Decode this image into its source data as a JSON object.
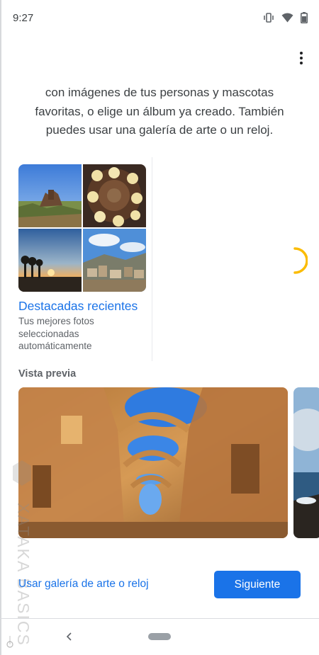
{
  "status_bar": {
    "time": "9:27",
    "icons": [
      "vibrate-icon",
      "wifi-icon",
      "battery-icon"
    ]
  },
  "header": {
    "overflow_menu_icon": "more-vert-icon"
  },
  "intro": {
    "text": "con imágenes de tus personas y mascotas favoritas, o elige un álbum ya creado. También puedes usar una galería de arte o un reloj."
  },
  "albums": [
    {
      "title": "Destacadas recientes",
      "description": "Tus mejores fotos seleccionadas automáticamente"
    }
  ],
  "loading": {
    "icon": "progress-spinner-icon",
    "color": "#fbbc04"
  },
  "preview": {
    "label": "Vista previa"
  },
  "watermark": {
    "text": "XATAKA BASICS"
  },
  "actions": {
    "secondary_label": "Usar galería de arte o reloj",
    "primary_label": "Siguiente"
  },
  "navigation": {
    "back_icon": "back-chevron-icon",
    "home_icon": "home-pill-icon"
  },
  "colors": {
    "accent": "#1a73e8",
    "spinner": "#fbbc04",
    "secondary_text": "#5f6368"
  }
}
